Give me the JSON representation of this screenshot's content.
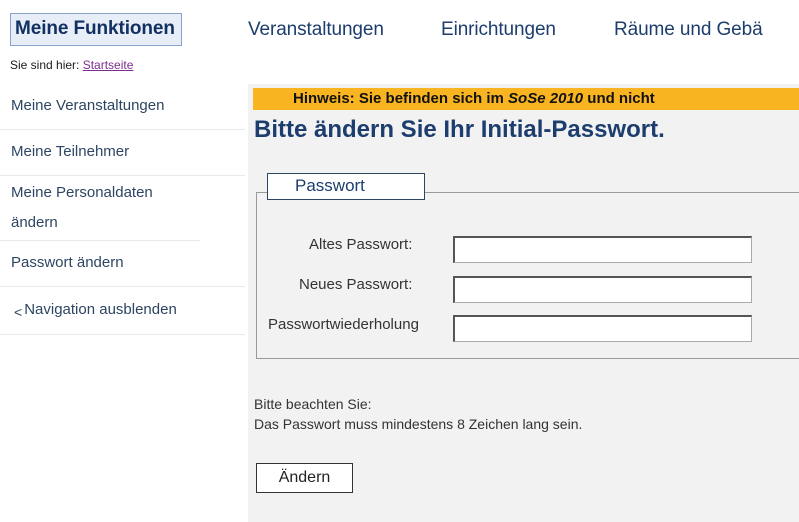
{
  "topnav": {
    "tabs": [
      {
        "label": "Meine Funktionen",
        "active": true
      },
      {
        "label": "Veranstaltungen"
      },
      {
        "label": "Einrichtungen"
      },
      {
        "label": "Räume und Gebä"
      }
    ]
  },
  "breadcrumb": {
    "prefix": "Sie sind hier:",
    "link": "Startseite"
  },
  "sidebar": {
    "items": [
      {
        "label": "Meine Veranstaltungen"
      },
      {
        "label": "Meine Teilnehmer"
      },
      {
        "label": "Meine Personaldaten ändern"
      },
      {
        "label": "Passwort ändern"
      }
    ],
    "hide_nav_arrow": "<",
    "hide_nav_label": "Navigation ausblenden"
  },
  "main": {
    "notice_prefix": "Hinweis: Sie befinden sich im ",
    "notice_semester": "SoSe 2010",
    "notice_suffix": " und nicht",
    "title": "Bitte ändern Sie Ihr Initial-Passwort.",
    "fieldset_legend": "Passwort",
    "fields": [
      {
        "label": "Altes Passwort:",
        "value": ""
      },
      {
        "label": "Neues Passwort:",
        "value": ""
      },
      {
        "label": "Passwortwiederholung",
        "value": ""
      }
    ],
    "hint_line1": "Bitte beachten Sie:",
    "hint_line2": "Das Passwort muss mindestens 8 Zeichen lang sein.",
    "submit_label": "Ändern"
  },
  "colors": {
    "notice_background": "#f8b521",
    "nav_text": "#1c3d6e",
    "main_background": "#f2f2f2",
    "breadcrumb_link": "#7a2f8c"
  }
}
